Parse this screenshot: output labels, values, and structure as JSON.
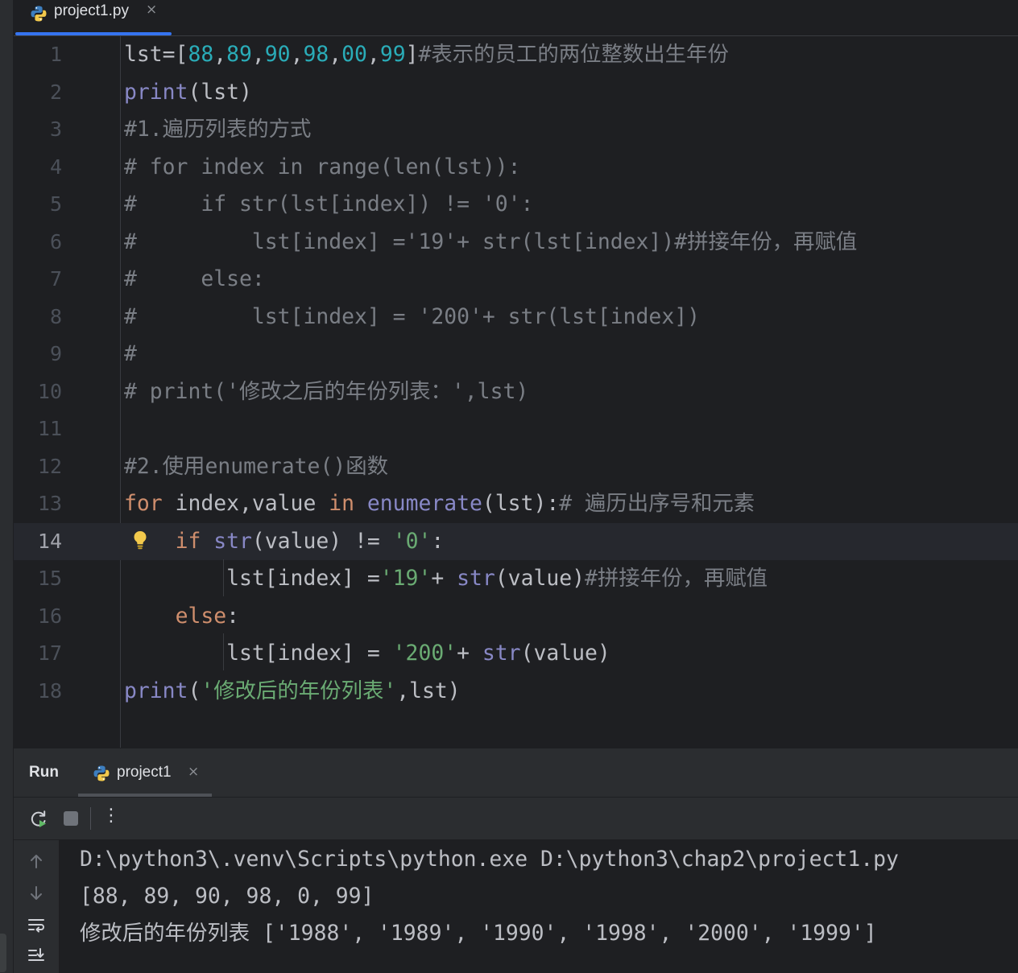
{
  "editor_tab": {
    "file_name": "project1.py",
    "close_symbol": "×",
    "icon": "python-file-icon"
  },
  "editor": {
    "current_line": 14,
    "lines": [
      {
        "num": "1",
        "parts": [
          {
            "t": "lst=[",
            "c": ""
          },
          {
            "t": "88",
            "c": "n"
          },
          {
            "t": ",",
            "c": ""
          },
          {
            "t": "89",
            "c": "n"
          },
          {
            "t": ",",
            "c": ""
          },
          {
            "t": "90",
            "c": "n"
          },
          {
            "t": ",",
            "c": ""
          },
          {
            "t": "98",
            "c": "n"
          },
          {
            "t": ",",
            "c": ""
          },
          {
            "t": "00",
            "c": "n"
          },
          {
            "t": ",",
            "c": ""
          },
          {
            "t": "99",
            "c": "n"
          },
          {
            "t": "]",
            "c": ""
          },
          {
            "t": "#表示的员工的两位整数出生年份",
            "c": "c"
          }
        ]
      },
      {
        "num": "2",
        "parts": [
          {
            "t": "print",
            "c": "b"
          },
          {
            "t": "(lst)",
            "c": ""
          }
        ]
      },
      {
        "num": "3",
        "parts": [
          {
            "t": "#1.遍历列表的方式",
            "c": "c"
          }
        ]
      },
      {
        "num": "4",
        "parts": [
          {
            "t": "# for index in range(len(lst)):",
            "c": "c"
          }
        ]
      },
      {
        "num": "5",
        "parts": [
          {
            "t": "#     if str(lst[index]) != '0':",
            "c": "c"
          }
        ]
      },
      {
        "num": "6",
        "parts": [
          {
            "t": "#         lst[index] ='19'+ str(lst[index])#拼接年份，再赋值",
            "c": "c"
          }
        ]
      },
      {
        "num": "7",
        "parts": [
          {
            "t": "#     else:",
            "c": "c"
          }
        ]
      },
      {
        "num": "8",
        "parts": [
          {
            "t": "#         lst[index] = '200'+ str(lst[index])",
            "c": "c"
          }
        ]
      },
      {
        "num": "9",
        "parts": [
          {
            "t": "#",
            "c": "c"
          }
        ]
      },
      {
        "num": "10",
        "parts": [
          {
            "t": "# print('修改之后的年份列表：',lst)",
            "c": "c"
          }
        ]
      },
      {
        "num": "11",
        "parts": []
      },
      {
        "num": "12",
        "parts": [
          {
            "t": "#2.使用enumerate()函数",
            "c": "c"
          }
        ]
      },
      {
        "num": "13",
        "parts": [
          {
            "t": "for",
            "c": "k"
          },
          {
            "t": " index,value ",
            "c": ""
          },
          {
            "t": "in",
            "c": "k"
          },
          {
            "t": " ",
            "c": ""
          },
          {
            "t": "enumerate",
            "c": "b"
          },
          {
            "t": "(lst):",
            "c": ""
          },
          {
            "t": "# 遍历出序号和元素",
            "c": "c"
          }
        ]
      },
      {
        "num": "14",
        "parts": [
          {
            "t": "    ",
            "c": ""
          },
          {
            "t": "if",
            "c": "k"
          },
          {
            "t": " ",
            "c": ""
          },
          {
            "t": "str",
            "c": "b"
          },
          {
            "t": "(value) != ",
            "c": ""
          },
          {
            "t": "'0'",
            "c": "s"
          },
          {
            "t": ":",
            "c": ""
          }
        ]
      },
      {
        "num": "15",
        "parts": [
          {
            "t": "        lst[index] =",
            "c": ""
          },
          {
            "t": "'19'",
            "c": "s"
          },
          {
            "t": "+ ",
            "c": ""
          },
          {
            "t": "str",
            "c": "b"
          },
          {
            "t": "(value)",
            "c": ""
          },
          {
            "t": "#拼接年份，再赋值",
            "c": "c"
          }
        ]
      },
      {
        "num": "16",
        "parts": [
          {
            "t": "    ",
            "c": ""
          },
          {
            "t": "else",
            "c": "k"
          },
          {
            "t": ":",
            "c": ""
          }
        ]
      },
      {
        "num": "17",
        "parts": [
          {
            "t": "        lst[index] = ",
            "c": ""
          },
          {
            "t": "'200'",
            "c": "s"
          },
          {
            "t": "+ ",
            "c": ""
          },
          {
            "t": "str",
            "c": "b"
          },
          {
            "t": "(value)",
            "c": ""
          }
        ]
      },
      {
        "num": "18",
        "parts": [
          {
            "t": "print",
            "c": "b"
          },
          {
            "t": "(",
            "c": ""
          },
          {
            "t": "'修改后的年份列表'",
            "c": "s"
          },
          {
            "t": ",lst)",
            "c": ""
          }
        ]
      }
    ]
  },
  "run_panel": {
    "title": "Run",
    "tab_label": "project1",
    "close_symbol": "×",
    "toolbar": {
      "rerun_icon": "rerun-icon",
      "stop_icon": "stop-icon",
      "more_symbol": "⋮"
    },
    "side_icons": [
      "up-arrow-icon",
      "down-arrow-icon",
      "soft-wrap-icon",
      "scroll-to-end-icon"
    ],
    "console_lines": [
      "D:\\python3\\.venv\\Scripts\\python.exe D:\\python3\\chap2\\project1.py",
      "[88, 89, 90, 98, 0, 99]",
      "修改后的年份列表 ['1988', '1989', '1990', '1998', '2000', '1999']"
    ]
  },
  "colors": {
    "background": "#1e1f22",
    "panel": "#2b2d30",
    "keyword": "#cf8e6d",
    "builtin": "#8888c6",
    "number": "#2aacb8",
    "string": "#6aab73",
    "comment": "#7a7e85",
    "accent": "#3574f0"
  }
}
